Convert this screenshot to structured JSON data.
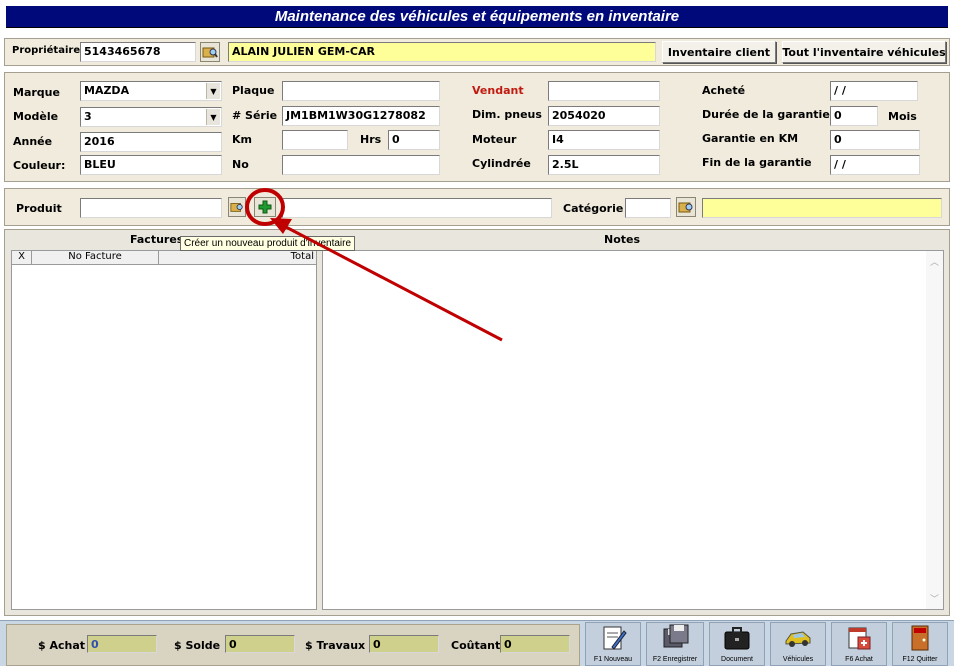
{
  "title": "Maintenance des véhicules et équipements en inventaire",
  "owner": {
    "label": "Propriétaire",
    "phone": "5143465678",
    "name": "ALAIN JULIEN GEM-CAR",
    "btn_client": "Inventaire client",
    "btn_all": "Tout l'inventaire véhicules"
  },
  "vehicle": {
    "marque_label": "Marque",
    "marque": "MAZDA",
    "modele_label": "Modèle",
    "modele": "3",
    "annee_label": "Année",
    "annee": "2016",
    "couleur_label": "Couleur:",
    "couleur": "BLEU",
    "plaque_label": "Plaque",
    "plaque": "",
    "serie_label": "# Série",
    "serie": "JM1BM1W30G1278082",
    "km_label": "Km",
    "km": "",
    "hrs_label": "Hrs",
    "hrs": "0",
    "no_label": "No",
    "no": "",
    "vendant_label": "Vendant",
    "vendant": "",
    "pneus_label": "Dim. pneus",
    "pneus": "2054020",
    "moteur_label": "Moteur",
    "moteur": "I4",
    "cyl_label": "Cylindrée",
    "cyl": "2.5L",
    "achete_label": "Acheté",
    "achete": " / /",
    "duree_label": "Durée de la garantie",
    "duree": "0",
    "mois_label": "Mois",
    "garkm_label": "Garantie en KM",
    "garkm": "0",
    "fin_label": "Fin de la garantie",
    "fin": " / /"
  },
  "product": {
    "label": "Produit",
    "code": "",
    "desc": "",
    "cat_label": "Catégorie",
    "cat": "",
    "cat_desc": ""
  },
  "tooltip": "Créer un nouveau produit d'inventaire",
  "factures": {
    "title": "Factures",
    "columns": [
      "X",
      "No Facture",
      "Total"
    ]
  },
  "notes": {
    "title": "Notes"
  },
  "totals": {
    "achat_label": "$ Achat",
    "achat": "0",
    "solde_label": "$ Solde",
    "solde": "0",
    "travaux_label": "$ Travaux",
    "travaux": "0",
    "coutant_label": "Coûtant",
    "coutant": "0"
  },
  "toolbar": [
    {
      "label": "F1 Nouveau",
      "icon": "new-document-icon"
    },
    {
      "label": "F2 Enregistrer",
      "icon": "save-disk-icon"
    },
    {
      "label": "Document",
      "icon": "briefcase-icon"
    },
    {
      "label": "Véhicules",
      "icon": "car-icon"
    },
    {
      "label": "F6 Achat",
      "icon": "purchase-calendar-icon"
    },
    {
      "label": "F12 Quitter",
      "icon": "exit-door-icon"
    }
  ],
  "colors": {
    "title_bg": "#00097a",
    "panel_bg": "#f0ebdc",
    "highlight": "#ffff99",
    "annotation": "#c00000"
  }
}
